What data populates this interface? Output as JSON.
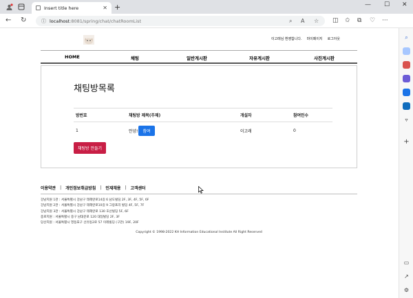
{
  "browser": {
    "tab_title": "Insert title here",
    "url_host": "localhost",
    "url_path": ":8081/spring/chat/chatRoomList"
  },
  "header": {
    "welcome": "이고래님 환영합니다.",
    "mypage": "마이페이지",
    "logout": "로그아웃"
  },
  "nav": {
    "items": [
      "HOME",
      "채팅",
      "일반게시판",
      "자유게시판",
      "사진게시판"
    ]
  },
  "main": {
    "title": "채팅방목록",
    "columns": [
      "방번호",
      "채팅방 제목(주제)",
      "개설자",
      "참여인수"
    ],
    "rows": [
      {
        "no": "1",
        "title": "안녕!",
        "join_label": "참여",
        "creator": "이고래",
        "count": "0"
      }
    ],
    "create_label": "채팅방 만들기"
  },
  "footer": {
    "links": [
      "이용약관",
      "개인정보취급방침",
      "인재채용",
      "고객센터"
    ],
    "separator": "|",
    "branches": [
      "강남지원 1관 : 서울특별시 강남구 테헤란로14길 6 남도빌딩 2F, 3F, 4F, 5F, 6F",
      "강남지원 2관 : 서울특별시 강남구 테헤란로10길 9 그랑프리 빌딩 4F, 5F, 7F",
      "강남지원 3관 : 서울특별시 강남구 테헤란로 130 호산빌딩 5F, 6F",
      "종로지원 : 서울특별시 중구 남대문로 120 대일빌딩 2F, 3F",
      "당산지원 : 서울특별시 영등포구 선유동2로 57 이레빌딩 (구관) 19F, 20F"
    ],
    "copyright": "Copyright © 1998-2022 KH Information Educational Institute All Right Reserved"
  },
  "colors": {
    "join_button": "#1a73e8",
    "create_button": "#c81e45"
  }
}
